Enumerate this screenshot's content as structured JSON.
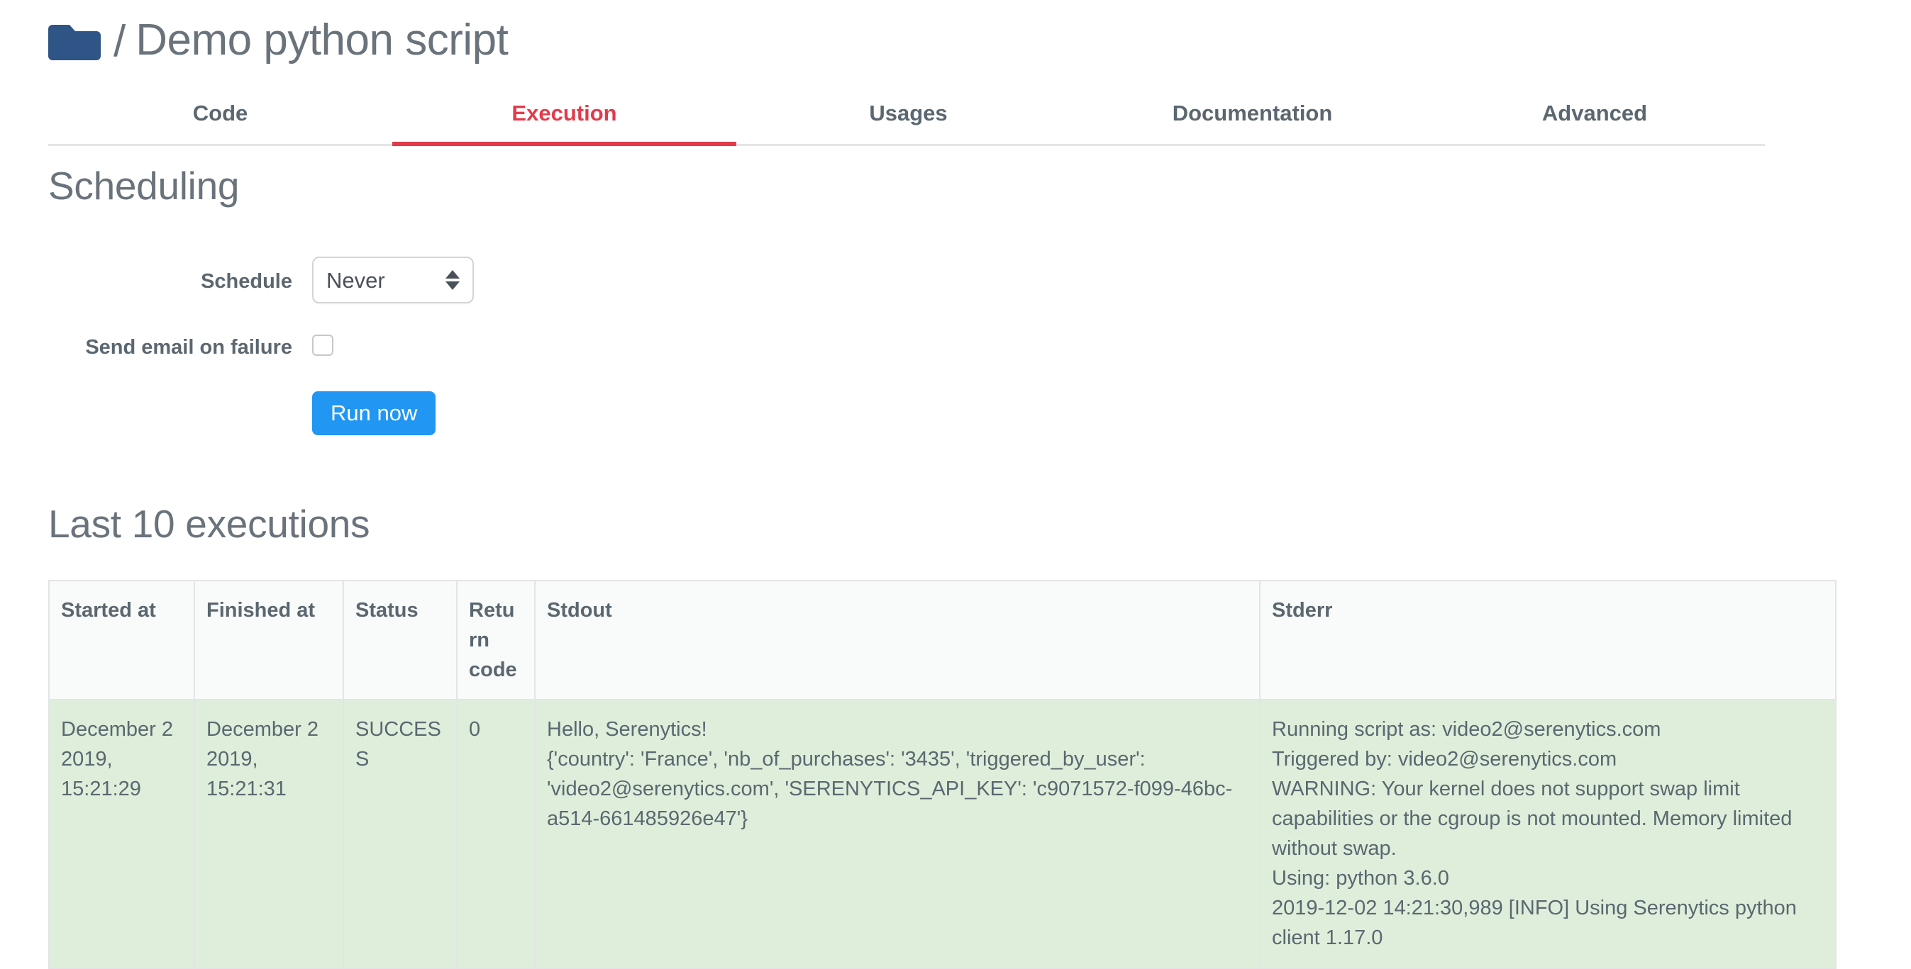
{
  "header": {
    "folder_icon": "folder-icon",
    "separator": "/",
    "title": "Demo python script",
    "folder_color": "#2f5486"
  },
  "tabs": [
    {
      "label": "Code",
      "active": false
    },
    {
      "label": "Execution",
      "active": true
    },
    {
      "label": "Usages",
      "active": false
    },
    {
      "label": "Documentation",
      "active": false
    },
    {
      "label": "Advanced",
      "active": false
    }
  ],
  "tabs_accent": "#e23b4b",
  "scheduling": {
    "section_title": "Scheduling",
    "schedule_label": "Schedule",
    "schedule_value": "Never",
    "schedule_options": [
      "Never"
    ],
    "email_label": "Send email on failure",
    "email_checked": false,
    "run_now_label": "Run now",
    "run_now_color": "#2196f3"
  },
  "executions": {
    "section_title": "Last 10 executions",
    "columns": [
      "Started at",
      "Finished at",
      "Status",
      "Return code",
      "Stdout",
      "Stderr"
    ],
    "row_color": "#dfeedb",
    "rows": [
      {
        "started_at": "December 2 2019, 15:21:29",
        "finished_at": "December 2 2019, 15:21:31",
        "status": "SUCCESS",
        "return_code": "0",
        "stdout": "Hello, Serenytics!\n{'country': 'France', 'nb_of_purchases': '3435', 'triggered_by_user': 'video2@serenytics.com', 'SERENYTICS_API_KEY': 'c9071572-f099-46bc-a514-661485926e47'}",
        "stderr": "Running script as: video2@serenytics.com\nTriggered by: video2@serenytics.com\nWARNING: Your kernel does not support swap limit capabilities or the cgroup is not mounted. Memory limited without swap.\nUsing: python 3.6.0\n2019-12-02 14:21:30,989 [INFO] Using Serenytics python client 1.17.0"
      }
    ]
  }
}
